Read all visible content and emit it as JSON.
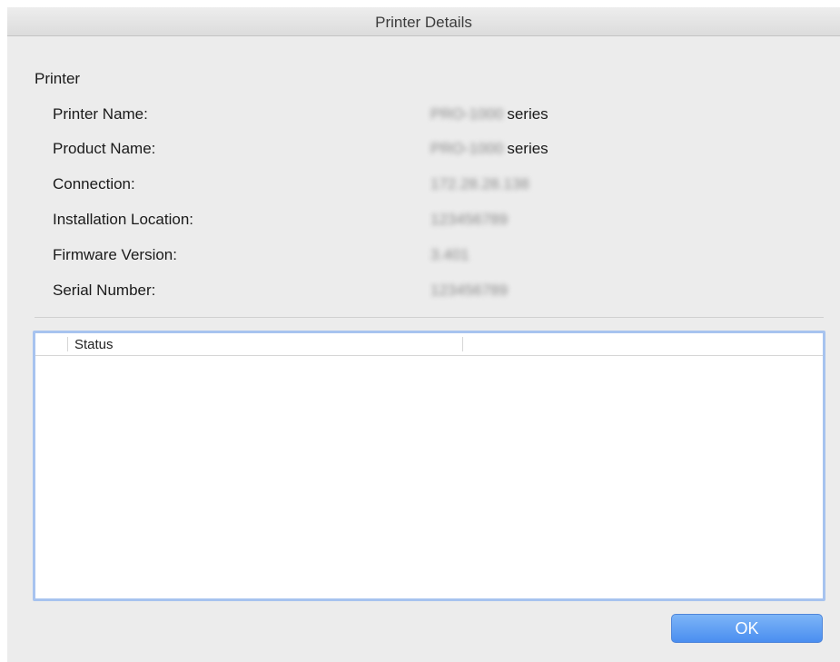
{
  "window": {
    "title": "Printer Details"
  },
  "printer": {
    "group_label": "Printer",
    "rows": [
      {
        "label": "Printer Name:",
        "value": "PRO-1000",
        "suffix": "series"
      },
      {
        "label": "Product Name:",
        "value": "PRO-1000",
        "suffix": "series"
      },
      {
        "label": "Connection:",
        "value": "172.28.28.138",
        "suffix": ""
      },
      {
        "label": "Installation Location:",
        "value": "123456789",
        "suffix": ""
      },
      {
        "label": "Firmware Version:",
        "value": "3.401",
        "suffix": ""
      },
      {
        "label": "Serial Number:",
        "value": "123456789",
        "suffix": ""
      }
    ]
  },
  "status_table": {
    "column_header": "Status"
  },
  "buttons": {
    "ok_label": "OK"
  },
  "colors": {
    "accent": "#4a8ef0",
    "focus_ring": "#a7c3ef"
  }
}
